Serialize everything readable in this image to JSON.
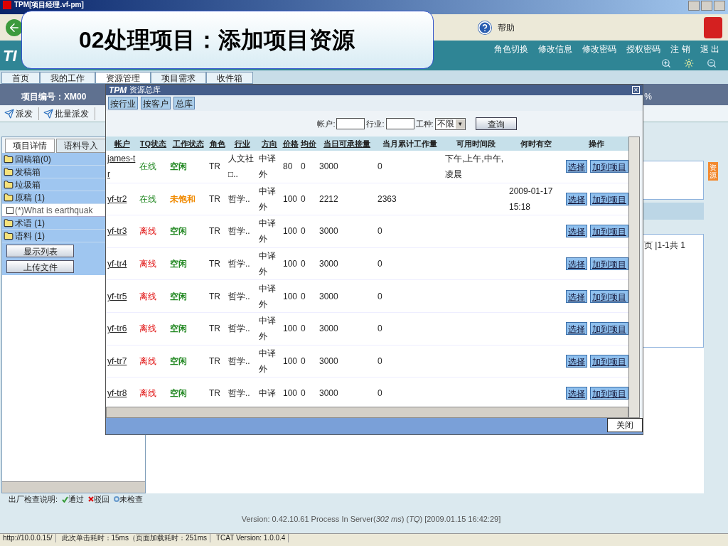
{
  "window": {
    "title": "TPM[项目经理.vf-pm]"
  },
  "callout": "02处理项目：添加项目资源",
  "toolbar": {
    "help": "帮助"
  },
  "header": {
    "logo": "TI",
    "links": [
      "角色切换",
      "修改信息",
      "修改密码",
      "授权密码",
      "注 销",
      "退 出"
    ]
  },
  "nav_tabs": [
    {
      "label": "首页",
      "selected": false
    },
    {
      "label": "我的工作",
      "selected": false
    },
    {
      "label": "资源管理",
      "selected": true
    },
    {
      "label": "项目需求",
      "selected": false
    },
    {
      "label": "收件箱",
      "selected": false
    }
  ],
  "project_bar": {
    "label": "项目编号：XM00",
    "percent": "%"
  },
  "actions": [
    "派发",
    "批量派发"
  ],
  "left_tabs": [
    {
      "label": "项目详情",
      "selected": true
    },
    {
      "label": "语料导入",
      "selected": false
    }
  ],
  "tree": [
    {
      "kind": "folder",
      "label": "回稿箱(0)"
    },
    {
      "kind": "folder",
      "label": "发稿箱"
    },
    {
      "kind": "folder",
      "label": "垃圾箱"
    },
    {
      "kind": "folder",
      "label": "原稿 (1)"
    },
    {
      "kind": "file",
      "label": "(*)What is earthquak",
      "checked": false
    },
    {
      "kind": "folder",
      "label": "术语 (1)"
    },
    {
      "kind": "folder",
      "label": "语料 (1)"
    }
  ],
  "left_buttons": [
    "显示列表",
    "上传文件"
  ],
  "legend": {
    "label": "出厂检查说明:",
    "items": [
      {
        "kind": "pass",
        "label": "通过",
        "color": "#339933"
      },
      {
        "kind": "reject",
        "label": "驳回",
        "color": "#dd0000"
      },
      {
        "kind": "unchecked",
        "label": "未检查",
        "color": "#6699cc"
      }
    ]
  },
  "version": "Version: 0.42.10.61 Process In Server(*302 ms*) (*TQ*) [2009.01.15 16:42:29]",
  "pager": "页 |1-1共 1",
  "side_tab": "资源",
  "dialog": {
    "brand": "TPM",
    "title": "资源总库",
    "close_glyph": "×",
    "tabs": [
      "按行业",
      "按客户",
      "总库"
    ],
    "filters": {
      "account_label": "帐户:",
      "industry_label": "行业:",
      "type_label": "工种:",
      "type_value": "不限",
      "dropdown_glyph": "▼",
      "search": "查询"
    },
    "columns": [
      "帐户",
      "TQ状态",
      "工作状态",
      "角色",
      "行业",
      "方向",
      "价格",
      "均价",
      "当日可承接量",
      "当月累计工作量",
      "可用时间段",
      "何时有空",
      "操作"
    ],
    "rows": [
      {
        "account": "james-tr",
        "tq": "在线",
        "online": true,
        "work": {
          "label": "空闲",
          "color": "#228822"
        },
        "role": "TR",
        "industry": "人文社□..",
        "direction": "中译外",
        "price": "80",
        "avg": "0",
        "daily": "3000",
        "monthly": "0",
        "slots": "下午,上午,中午,凌晨",
        "free": "",
        "actions": [
          "选择",
          "加到项目"
        ]
      },
      {
        "account": "yf-tr2",
        "tq": "在线",
        "online": true,
        "work": {
          "label": "未饱和",
          "color": "#f08a00"
        },
        "role": "TR",
        "industry": "哲学..",
        "direction": "中译外",
        "price": "100",
        "avg": "0",
        "daily": "2212",
        "monthly": "2363",
        "slots": "",
        "free": "2009-01-17 15:18",
        "actions": [
          "选择",
          "加到项目"
        ]
      },
      {
        "account": "yf-tr3",
        "tq": "离线",
        "online": false,
        "work": {
          "label": "空闲",
          "color": "#228822"
        },
        "role": "TR",
        "industry": "哲学..",
        "direction": "中译外",
        "price": "100",
        "avg": "0",
        "daily": "3000",
        "monthly": "0",
        "slots": "",
        "free": "",
        "actions": [
          "选择",
          "加到项目"
        ]
      },
      {
        "account": "yf-tr4",
        "tq": "离线",
        "online": false,
        "work": {
          "label": "空闲",
          "color": "#228822"
        },
        "role": "TR",
        "industry": "哲学..",
        "direction": "中译外",
        "price": "100",
        "avg": "0",
        "daily": "3000",
        "monthly": "0",
        "slots": "",
        "free": "",
        "actions": [
          "选择",
          "加到项目"
        ]
      },
      {
        "account": "yf-tr5",
        "tq": "离线",
        "online": false,
        "work": {
          "label": "空闲",
          "color": "#228822"
        },
        "role": "TR",
        "industry": "哲学..",
        "direction": "中译外",
        "price": "100",
        "avg": "0",
        "daily": "3000",
        "monthly": "0",
        "slots": "",
        "free": "",
        "actions": [
          "选择",
          "加到项目"
        ]
      },
      {
        "account": "yf-tr6",
        "tq": "离线",
        "online": false,
        "work": {
          "label": "空闲",
          "color": "#228822"
        },
        "role": "TR",
        "industry": "哲学..",
        "direction": "中译外",
        "price": "100",
        "avg": "0",
        "daily": "3000",
        "monthly": "0",
        "slots": "",
        "free": "",
        "actions": [
          "选择",
          "加到项目"
        ]
      },
      {
        "account": "yf-tr7",
        "tq": "离线",
        "online": false,
        "work": {
          "label": "空闲",
          "color": "#228822"
        },
        "role": "TR",
        "industry": "哲学..",
        "direction": "中译外",
        "price": "100",
        "avg": "0",
        "daily": "3000",
        "monthly": "0",
        "slots": "",
        "free": "",
        "actions": [
          "选择",
          "加到项目"
        ]
      },
      {
        "account": "yf-tr8",
        "tq": "离线",
        "online": false,
        "work": {
          "label": "空闲",
          "color": "#228822"
        },
        "role": "TR",
        "industry": "哲学..",
        "direction": "中译",
        "price": "100",
        "avg": "0",
        "daily": "3000",
        "monthly": "0",
        "slots": "",
        "free": "",
        "actions": [
          "选择",
          "加到项目"
        ]
      }
    ],
    "close": "关闭"
  },
  "status_bar": [
    "http://10.0.0.15/",
    "此次单击耗时：15ms（页面加载耗时：251ms",
    "TCAT Version: 1.0.0.4"
  ]
}
